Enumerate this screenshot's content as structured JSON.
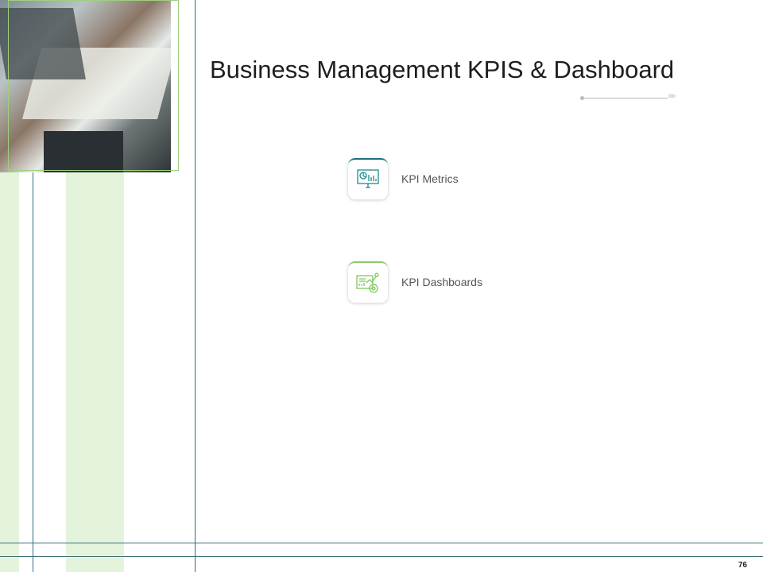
{
  "title": "Business Management KPIS & Dashboard",
  "items": [
    {
      "label": "KPI Metrics",
      "icon": "monitor-chart-icon",
      "color": "#1f8a8f"
    },
    {
      "label": "KPI Dashboards",
      "icon": "dashboard-gear-icon",
      "color": "#7cc85a"
    }
  ],
  "page_number": "76"
}
